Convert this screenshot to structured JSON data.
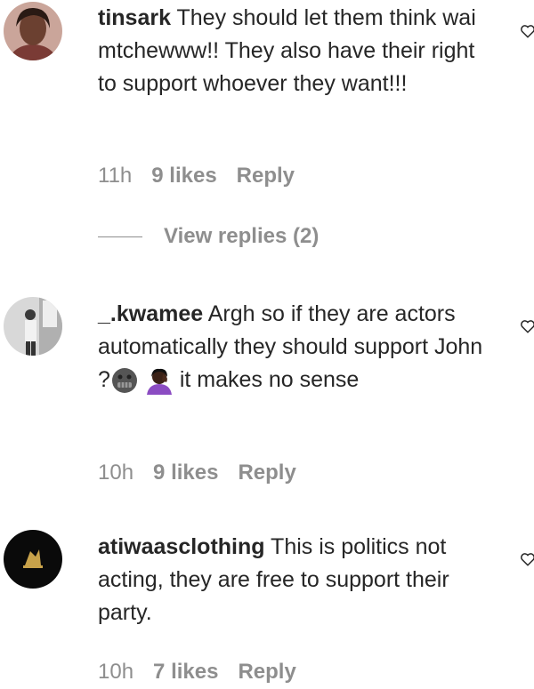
{
  "comments": [
    {
      "username": "tinsark",
      "text": "They should let them think wai mtchewww!! They also have their right to support whoever they want!!!",
      "time": "11h",
      "likes": "9 likes",
      "reply": "Reply"
    },
    {
      "username": "_.kwamee",
      "text_before": "Argh so if they are actors automatically they should support John ?",
      "text_after": "it makes no sense",
      "time": "10h",
      "likes": "9 likes",
      "reply": "Reply"
    },
    {
      "username": "atiwaasclothing",
      "text": "This is politics not acting, they are free to support their party.",
      "time": "10h",
      "likes": "7 likes",
      "reply": "Reply"
    }
  ],
  "view_replies": "View replies (2)",
  "icons": {
    "like": "heart-icon",
    "emoji_1": "grimacing-face-emoji",
    "emoji_2": "person-facepalming-emoji"
  },
  "colors": {
    "text": "#262626",
    "secondary": "#8e8e8e",
    "background": "#ffffff"
  }
}
